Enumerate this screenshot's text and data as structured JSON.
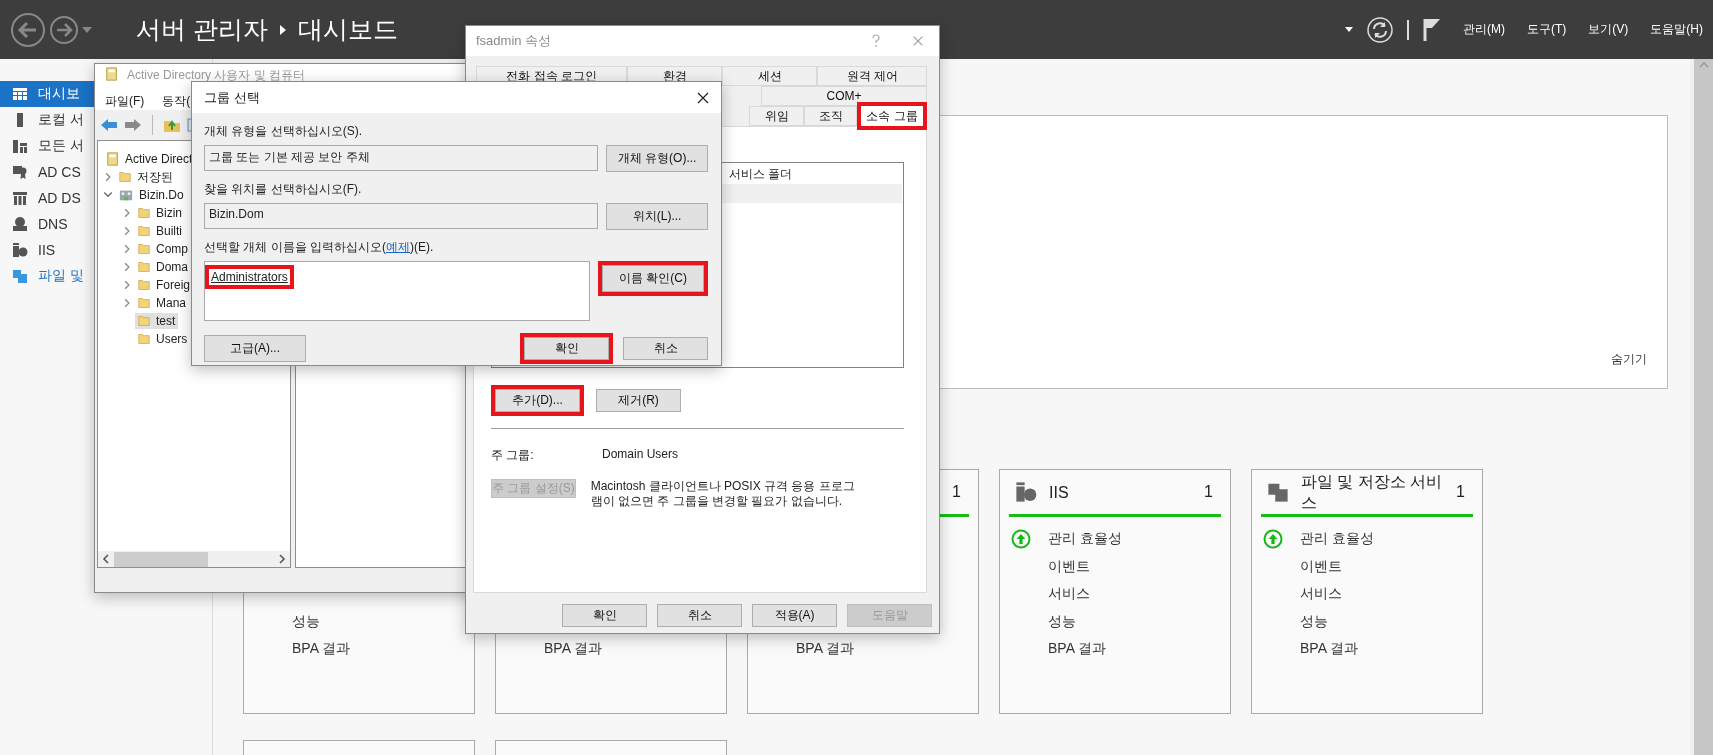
{
  "topbar": {
    "title": "서버 관리자",
    "page": "대시보드",
    "menus": [
      "관리(M)",
      "도구(T)",
      "보기(V)",
      "도움말(H)"
    ]
  },
  "sidebar": {
    "items": [
      {
        "label": "대시보",
        "selected": true,
        "hover": false
      },
      {
        "label": "로컬 서",
        "selected": false,
        "hover": false
      },
      {
        "label": "모든 서",
        "selected": false,
        "hover": false
      },
      {
        "label": "AD CS",
        "selected": false,
        "hover": false
      },
      {
        "label": "AD DS",
        "selected": false,
        "hover": false
      },
      {
        "label": "DNS",
        "selected": false,
        "hover": false
      },
      {
        "label": "IIS",
        "selected": false,
        "hover": false
      },
      {
        "label": "파일 및",
        "selected": false,
        "hover": true
      }
    ]
  },
  "welcome": {
    "hide_link": "숨기기"
  },
  "tiles": [
    {
      "items": [
        {
          "label": "성능"
        },
        {
          "label": "BPA 결과"
        }
      ]
    },
    {
      "items": [
        {
          "label": "BPA 결과"
        }
      ]
    },
    {
      "count": "1",
      "ok": true,
      "items": [
        {
          "label": "BPA 결과"
        }
      ]
    },
    {
      "title": "IIS",
      "count": "1",
      "ok": true,
      "items": [
        {
          "label": "관리 효율성",
          "ok": true
        },
        {
          "label": "이벤트"
        },
        {
          "label": "서비스"
        },
        {
          "label": "성능"
        },
        {
          "label": "BPA 결과"
        }
      ]
    },
    {
      "title": "파일 및 저장소 서비스",
      "count": "1",
      "ok": true,
      "items": [
        {
          "label": "관리 효율성",
          "ok": true
        },
        {
          "label": "이벤트"
        },
        {
          "label": "서비스"
        },
        {
          "label": "성능"
        },
        {
          "label": "BPA 결과"
        }
      ]
    }
  ],
  "ad_window": {
    "title": "Active Directory 사용자 및 컴퓨터",
    "menus": [
      "파일(F)",
      "동작("
    ],
    "tree": [
      {
        "label": "Active Direct",
        "selected": false,
        "children": [
          {
            "label": "저장된",
            "expanded": false,
            "selected": false
          },
          {
            "label": "Bizin.Do",
            "expanded": true,
            "selected": false,
            "children": [
              {
                "label": "Bizin",
                "expanded": false,
                "selected": false
              },
              {
                "label": "Builti",
                "expanded": false,
                "selected": false
              },
              {
                "label": "Comp",
                "expanded": false,
                "selected": false
              },
              {
                "label": "Doma",
                "expanded": false,
                "selected": false
              },
              {
                "label": "Foreig",
                "expanded": false,
                "selected": false
              },
              {
                "label": "Mana",
                "expanded": false,
                "selected": false
              },
              {
                "label": "test",
                "selected": true
              },
              {
                "label": "Users",
                "selected": false
              }
            ]
          }
        ]
      }
    ]
  },
  "props_window": {
    "title": "fsadmin 속성",
    "tab_rows": [
      {
        "tabs": [
          {
            "label": "전화 접속 로그인",
            "selected": false,
            "highlighted": false
          },
          {
            "label": "환경",
            "selected": false,
            "highlighted": false
          },
          {
            "label": "세션",
            "selected": false,
            "highlighted": false
          },
          {
            "label": "원격 제어",
            "selected": false,
            "highlighted": false
          }
        ]
      },
      {
        "tabs": [
          {
            "label": "COM+",
            "selected": false,
            "highlighted": false
          }
        ]
      },
      {
        "tabs": [
          {
            "label": "위임",
            "selected": false,
            "highlighted": false
          },
          {
            "label": "조직",
            "selected": false,
            "highlighted": false
          },
          {
            "label": "소속 그룹",
            "selected": true,
            "highlighted": true
          }
        ]
      }
    ],
    "members": [
      {
        "folder": "서비스 폴더",
        "selected": false
      },
      {
        "selected": true
      }
    ],
    "add_button": {
      "label": "추가(D)...",
      "highlighted": true
    },
    "remove_button": {
      "label": "제거(R)",
      "highlighted": false
    },
    "primary_label": "주 그룹:",
    "primary_value": "Domain Users",
    "set_primary_button": {
      "label": "주 그룹 설정(S)",
      "disabled": true
    },
    "note": "Macintosh 클라이언트나 POSIX 규격 응용 프로그램이 없으면 주 그룹을 변경할 필요가 없습니다.",
    "footer_buttons": [
      {
        "label": "확인",
        "disabled": false
      },
      {
        "label": "취소",
        "disabled": false
      },
      {
        "label": "적용(A)",
        "disabled": false
      },
      {
        "label": "도움말",
        "disabled": true
      }
    ]
  },
  "group_dialog": {
    "title": "그룹 선택",
    "type_label": "개체 유형을 선택하십시오(S).",
    "type_value": "그룹 또는 기본 제공 보안 주체",
    "type_button": {
      "label": "개체 유형(O)...",
      "highlighted": false
    },
    "location_label": "찾을 위치를 선택하십시오(F).",
    "location_value": "Bizin.Dom",
    "location_button": {
      "label": "위치(L)...",
      "highlighted": false
    },
    "names_label": "선택할 개체 이름을 입력하십시오(",
    "names_link": "예제",
    "names_label_end": ")(E).",
    "names_value": "Administrators",
    "names_value_highlighted": true,
    "check_button": {
      "label": "이름 확인(C)",
      "highlighted": true
    },
    "advanced_button": {
      "label": "고급(A)...",
      "highlighted": false
    },
    "ok_button": {
      "label": "확인",
      "highlighted": true
    },
    "cancel_button": {
      "label": "취소",
      "highlighted": false
    }
  }
}
